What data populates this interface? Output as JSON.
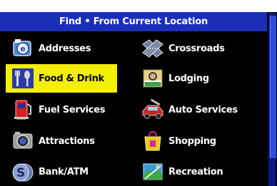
{
  "window": {
    "title": "Find • From Current Location"
  },
  "menu": {
    "items": [
      {
        "label": "Addresses",
        "icon": "addresses-icon",
        "selected": false
      },
      {
        "label": "Crossroads",
        "icon": "crossroads-icon",
        "selected": false
      },
      {
        "label": "Food & Drink",
        "icon": "food-drink-icon",
        "selected": true
      },
      {
        "label": "Lodging",
        "icon": "lodging-icon",
        "selected": false
      },
      {
        "label": "Fuel Services",
        "icon": "fuel-icon",
        "selected": false
      },
      {
        "label": "Auto Services",
        "icon": "auto-services-icon",
        "selected": false
      },
      {
        "label": "Attractions",
        "icon": "attractions-icon",
        "selected": false
      },
      {
        "label": "Shopping",
        "icon": "shopping-icon",
        "selected": false
      },
      {
        "label": "Bank/ATM",
        "icon": "bank-atm-icon",
        "selected": false
      },
      {
        "label": "Recreation",
        "icon": "recreation-icon",
        "selected": false
      }
    ]
  },
  "colors": {
    "titlebar": "#1a2fb8",
    "selection": "#f2ee05",
    "background": "#000000",
    "text": "#ffffff"
  }
}
